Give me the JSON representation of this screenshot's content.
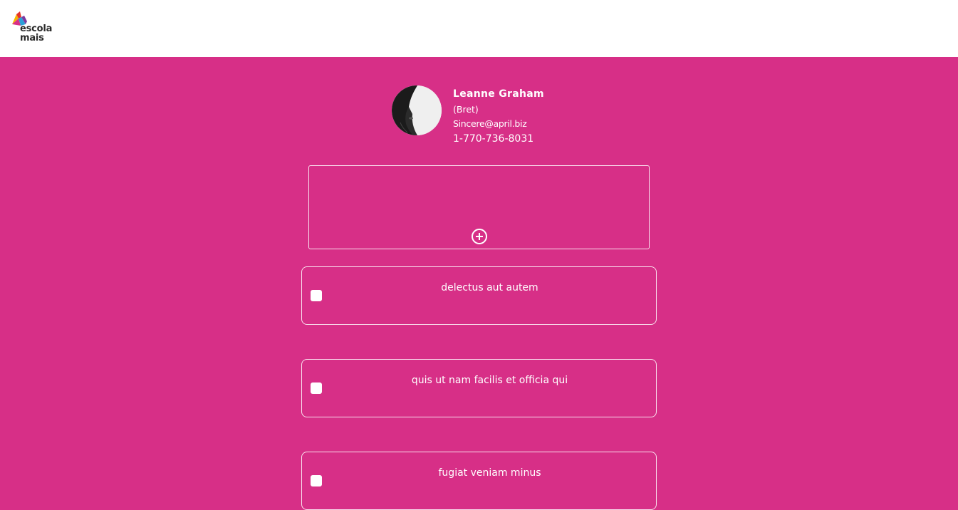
{
  "header": {
    "logo_line1": "escola",
    "logo_line2": "mais"
  },
  "profile": {
    "name": "Leanne Graham",
    "username": "(Bret)",
    "email": "Sincere@april.biz",
    "phone": "1-770-736-8031"
  },
  "add_todo": {
    "icon": "plus-circle-icon"
  },
  "todos": [
    {
      "title": "delectus aut autem"
    },
    {
      "title": "quis ut nam facilis et officia qui"
    },
    {
      "title": "fugiat veniam minus"
    }
  ],
  "colors": {
    "background": "#d72f87",
    "header": "#ffffff",
    "text": "#ffffff"
  }
}
